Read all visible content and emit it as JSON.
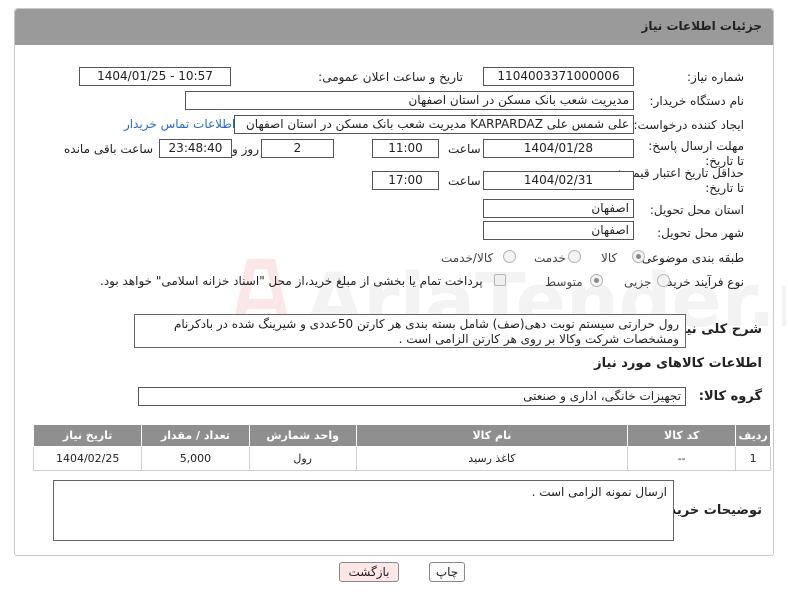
{
  "header": {
    "title": "جزئیات اطلاعات نیاز"
  },
  "fields": {
    "need_number_label": "شماره نیاز:",
    "need_number": "1104003371000006",
    "announce_label": "تاریخ و ساعت اعلان عمومی:",
    "announce_value": "1404/01/25 - 10:57",
    "buyer_org_label": "نام دستگاه خریدار:",
    "buyer_org": "مدیریت شعب بانک مسکن در استان اصفهان",
    "requester_label": "ایجاد کننده درخواست:",
    "requester": "علی شمس علی KARPARDAZ مدیریت شعب بانک مسکن در استان اصفهان",
    "contact_link": "اطلاعات تماس خریدار",
    "reply_deadline_label": "مهلت ارسال پاسخ: تا تاریخ:",
    "reply_date": "1404/01/28",
    "hour_label": "ساعت",
    "reply_hour": "11:00",
    "days_value": "2",
    "days_label": "روز و",
    "remaining_time": "23:48:40",
    "remaining_label": "ساعت باقی مانده",
    "price_validity_label": "حداقل تاریخ اعتبار قیمت: تا تاریخ:",
    "price_date": "1404/02/31",
    "price_hour": "17:00",
    "province_label": "استان محل تحویل:",
    "province": "اصفهان",
    "city_label": "شهر محل تحویل:",
    "city": "اصفهان",
    "category_label": "طبقه بندی موضوعی:",
    "category_options": [
      "کالا",
      "خدمت",
      "کالا/خدمت"
    ],
    "process_label": "نوع فرآیند خرید :",
    "process_options": [
      "جزیی",
      "متوسط"
    ],
    "payment_note": "پرداخت تمام یا بخشی از مبلغ خرید،از محل \"اسناد خزانه اسلامی\" خواهد بود."
  },
  "description": {
    "label": "شرح کلی نیاز:",
    "text": "رول حرارتی سیستم نوبت دهی(صف) شامل بسته بندی  هر کارتن 50عددی و شیرینگ شده در بادکرنام ومشخصات شرکت وکالا بر روی هر کارتن الزامی است ."
  },
  "goods_section": {
    "title": "اطلاعات کالاهای مورد نیاز"
  },
  "goods_group": {
    "label": "گروه کالا:",
    "value": "تجهیزات خانگی، اداری و صنعتی"
  },
  "table": {
    "headers": [
      "ردیف",
      "کد کالا",
      "نام کالا",
      "واحد شمارش",
      "تعداد / مقدار",
      "تاریخ نیاز"
    ],
    "rows": [
      [
        "1",
        "--",
        "کاغذ رسید",
        "رول",
        "5,000",
        "1404/02/25"
      ]
    ]
  },
  "buyer_notes": {
    "label": "توضیحات خریدار:",
    "text": "ارسال نمونه الزامی است ."
  },
  "buttons": {
    "print": "چاپ",
    "back": "بازگشت"
  },
  "watermark": {
    "text": "AriaTender.neT"
  },
  "colors": {
    "header_bg": "#9a9a9a",
    "table_header_bg": "#8f8f8f",
    "link": "#2a6ad0",
    "back_button_bg": "#fde6e6"
  }
}
